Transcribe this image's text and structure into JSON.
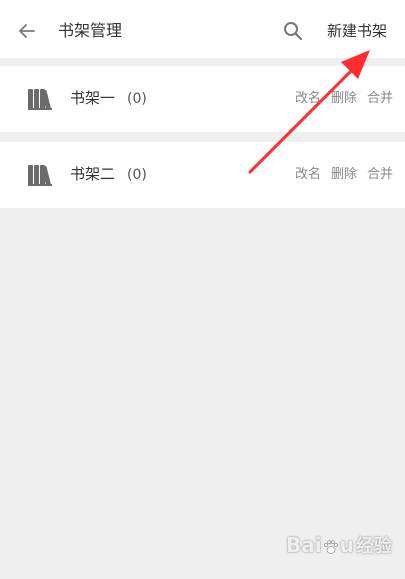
{
  "header": {
    "title": "书架管理",
    "new_label": "新建书架"
  },
  "shelves": [
    {
      "name": "书架一",
      "count": "(0)"
    },
    {
      "name": "书架二",
      "count": "(0)"
    }
  ],
  "row_actions": {
    "rename": "改名",
    "delete": "删除",
    "merge": "合并"
  },
  "icons": {
    "back": "arrow-left-icon",
    "search": "search-icon",
    "shelf": "books-icon"
  },
  "colors": {
    "background": "#efefef",
    "annotation_arrow": "#ff2d2d",
    "icon": "#666666"
  },
  "watermark": {
    "brand_left": "Bai",
    "brand_right": "u",
    "suffix": "经验"
  }
}
